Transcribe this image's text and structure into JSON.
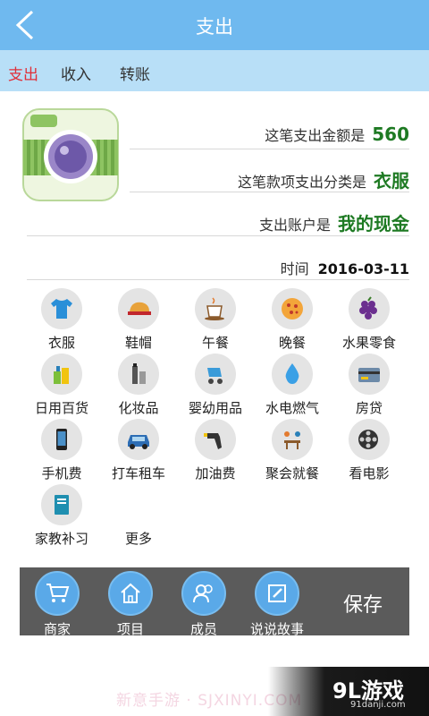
{
  "header": {
    "title": "支出"
  },
  "tabs": [
    {
      "label": "支出"
    },
    {
      "label": "收入"
    },
    {
      "label": "转账"
    }
  ],
  "summary": {
    "amount_label": "这笔支出金额是",
    "amount": "560",
    "category_label": "这笔款项支出分类是",
    "category": "衣服",
    "account_label": "支出账户是",
    "account": "我的现金",
    "time_label": "时间",
    "time": "2016-03-11"
  },
  "categories": [
    {
      "label": "衣服",
      "icon": "tshirt-icon"
    },
    {
      "label": "鞋帽",
      "icon": "cap-icon"
    },
    {
      "label": "午餐",
      "icon": "coffee-icon"
    },
    {
      "label": "晚餐",
      "icon": "pizza-icon"
    },
    {
      "label": "水果零食",
      "icon": "grapes-icon"
    },
    {
      "label": "日用百货",
      "icon": "groceries-icon"
    },
    {
      "label": "化妆品",
      "icon": "cosmetics-icon"
    },
    {
      "label": "婴幼用品",
      "icon": "stroller-icon"
    },
    {
      "label": "水电燃气",
      "icon": "water-drop-icon"
    },
    {
      "label": "房贷",
      "icon": "card-icon"
    },
    {
      "label": "手机费",
      "icon": "phone-icon"
    },
    {
      "label": "打车租车",
      "icon": "car-icon"
    },
    {
      "label": "加油费",
      "icon": "fuel-nozzle-icon"
    },
    {
      "label": "聚会就餐",
      "icon": "dining-icon"
    },
    {
      "label": "看电影",
      "icon": "film-reel-icon"
    },
    {
      "label": "家教补习",
      "icon": "book-icon"
    },
    {
      "label": "更多",
      "icon": ""
    }
  ],
  "bottom": {
    "items": [
      {
        "label": "商家"
      },
      {
        "label": "项目"
      },
      {
        "label": "成员"
      },
      {
        "label": "说说故事"
      }
    ],
    "save": "保存"
  },
  "watermark": {
    "text": "新意手游 · SJXINYI.COM",
    "logo": "9L游戏",
    "logo_sub": "91danji.com"
  }
}
